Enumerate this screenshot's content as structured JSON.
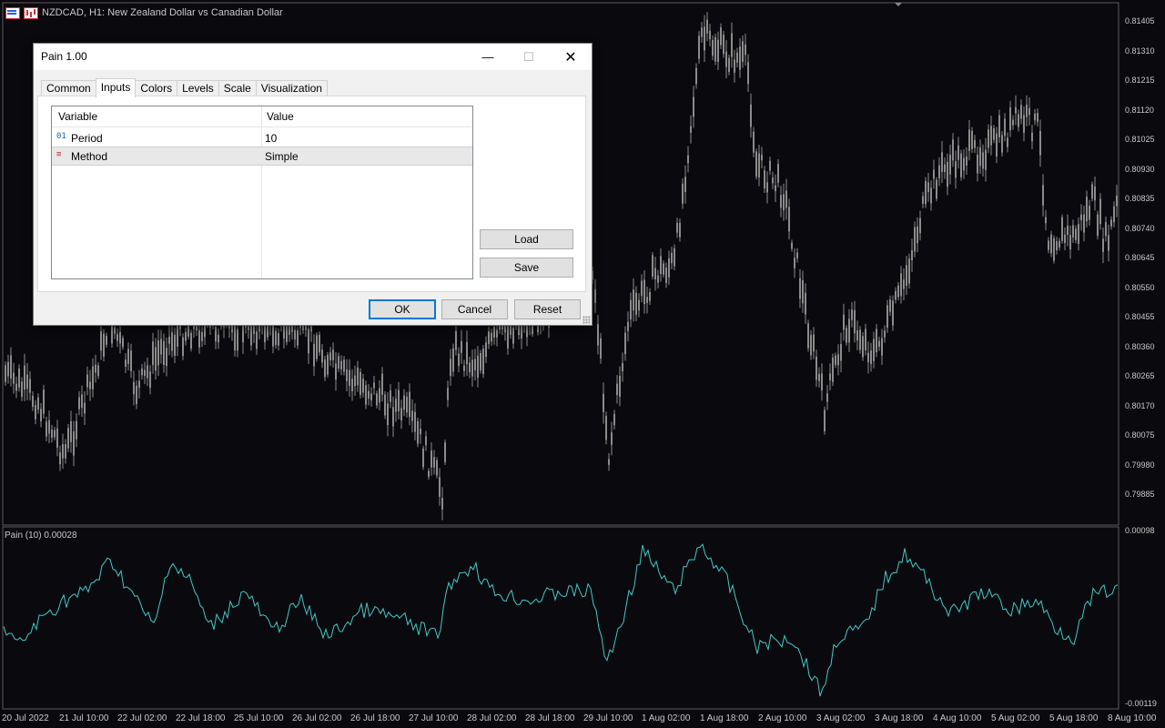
{
  "chart": {
    "symbol_text": "NZDCAD, H1:  New Zealand Dollar vs Canadian Dollar",
    "price_labels": [
      "0.81405",
      "0.81310",
      "0.81215",
      "0.81120",
      "0.81025",
      "0.80930",
      "0.80835",
      "0.80740",
      "0.80645",
      "0.80550",
      "0.80455",
      "0.80360",
      "0.80265",
      "0.80170",
      "0.80075",
      "0.79980",
      "0.79885"
    ],
    "time_labels": [
      "20 Jul 2022",
      "21 Jul 10:00",
      "22 Jul 02:00",
      "22 Jul 18:00",
      "25 Jul 10:00",
      "26 Jul 02:00",
      "26 Jul 18:00",
      "27 Jul 10:00",
      "28 Jul 02:00",
      "28 Jul 18:00",
      "29 Jul 10:00",
      "1 Aug 02:00",
      "1 Aug 18:00",
      "2 Aug 10:00",
      "3 Aug 02:00",
      "3 Aug 18:00",
      "4 Aug 10:00",
      "5 Aug 02:00",
      "5 Aug 18:00",
      "8 Aug 10:00"
    ],
    "subwindow_label": "Pain (10) 0.00028",
    "indicator_scale": [
      "0.00098",
      "-0.00119"
    ],
    "colors": {
      "background": "#0a0a0e",
      "candles": "#8c8c8c",
      "indicator_line": "#40c8c8",
      "grid": "#5a5a5a"
    }
  },
  "dialog": {
    "title": "Pain 1.00",
    "window_controls": {
      "minimize": "—",
      "maximize": "☐",
      "close": "✕"
    },
    "tabs": [
      {
        "label": "Common",
        "active": false
      },
      {
        "label": "Inputs",
        "active": true
      },
      {
        "label": "Colors",
        "active": false
      },
      {
        "label": "Levels",
        "active": false
      },
      {
        "label": "Scale",
        "active": false
      },
      {
        "label": "Visualization",
        "active": false
      }
    ],
    "grid": {
      "col_variable": "Variable",
      "col_value": "Value",
      "rows": [
        {
          "icon": "integer-type-icon",
          "glyph": "01",
          "variable": "Period",
          "value": "10",
          "selected": false
        },
        {
          "icon": "enum-type-icon",
          "glyph": "≡",
          "variable": "Method",
          "value": "Simple",
          "selected": true
        }
      ]
    },
    "buttons": {
      "load": "Load",
      "save": "Save",
      "ok": "OK",
      "cancel": "Cancel",
      "reset": "Reset"
    }
  }
}
